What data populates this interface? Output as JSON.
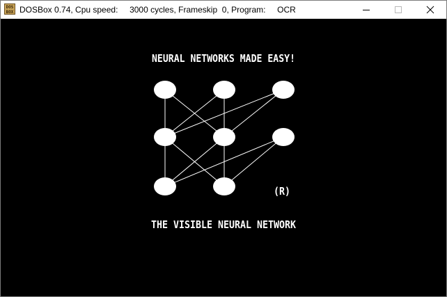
{
  "window": {
    "title": "DOSBox 0.74, Cpu speed:     3000 cycles, Frameskip  0, Program:     OCR",
    "icon": "dosbox-logo-icon",
    "icon_text_top": "DOS",
    "icon_text_bottom": "BOX",
    "controls": {
      "minimize_icon": "minimize-icon",
      "maximize_icon": "maximize-icon",
      "close_icon": "close-icon"
    }
  },
  "screen": {
    "background": "#000000",
    "foreground": "#ffffff",
    "heading": "NEURAL NETWORKS MADE EASY!",
    "footer": "THE VISIBLE NEURAL NETWORK",
    "registered_mark": "(R)"
  }
}
